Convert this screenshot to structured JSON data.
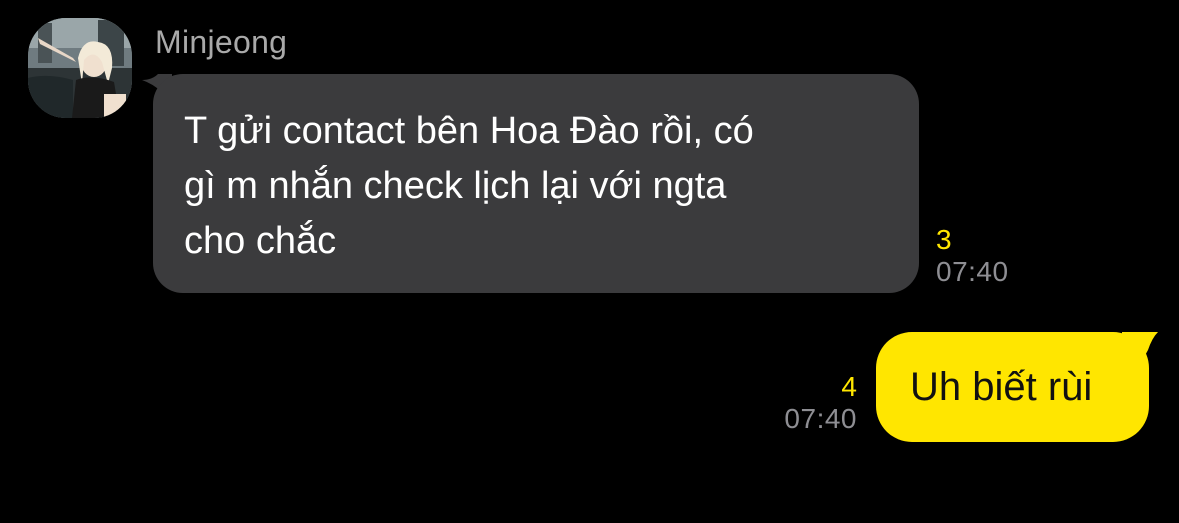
{
  "incoming": {
    "sender": "Minjeong",
    "avatar": "profile-photo",
    "lines": [
      "T gửi contact bên Hoa Đào rồi, có",
      "gì m nhắn check lịch lại với ngta",
      "cho chắc"
    ],
    "unread": "3",
    "time": "07:40"
  },
  "outgoing": {
    "text": "Uh biết rùi",
    "unread": "4",
    "time": "07:40"
  },
  "colors": {
    "background": "#000000",
    "incoming_bubble": "#3b3b3d",
    "outgoing_bubble": "#ffe600",
    "unread_count": "#ffe600",
    "timestamp": "#8e8e93"
  }
}
